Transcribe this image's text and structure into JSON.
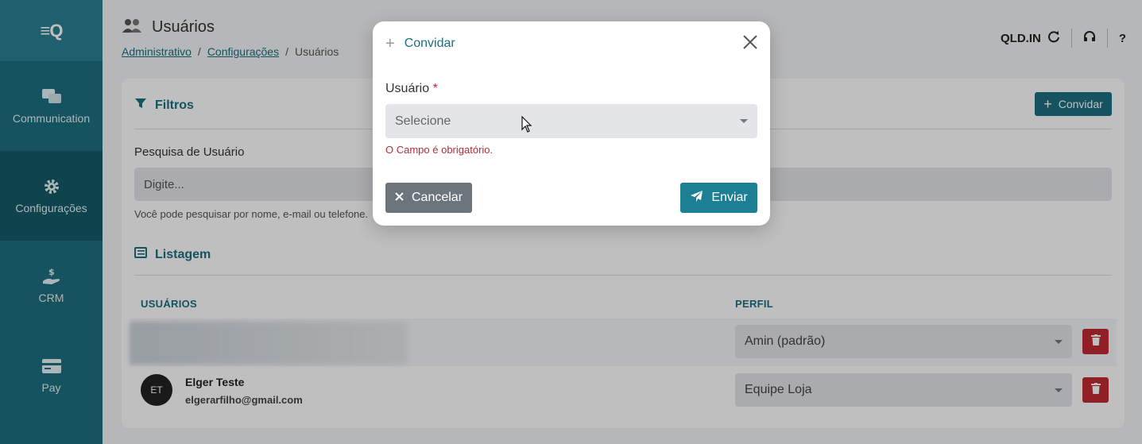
{
  "sidebar": {
    "logo": "≡Q",
    "items": [
      {
        "label": "Communication",
        "icon": "chat-icon"
      },
      {
        "label": "Configurações",
        "icon": "gear-icon"
      },
      {
        "label": "CRM",
        "icon": "money-hand-icon"
      },
      {
        "label": "Pay",
        "icon": "card-icon"
      }
    ]
  },
  "header": {
    "title": "Usuários",
    "breadcrumb": [
      "Administrativo",
      "Configurações",
      "Usuários"
    ],
    "separator": "/",
    "org": "QLD.IN",
    "help": "?"
  },
  "filters": {
    "title": "Filtros",
    "invite_label": "Convidar",
    "search_label": "Pesquisa de Usuário",
    "search_placeholder": "Digite...",
    "helper": "Você pode pesquisar por nome, e-mail ou telefone."
  },
  "listing": {
    "title": "Listagem",
    "col_users": "USUÁRIOS",
    "col_profile": "PERFIL",
    "rows": [
      {
        "initials": "",
        "name": "",
        "email": "",
        "profile": "Amin (padrão)"
      },
      {
        "initials": "ET",
        "name": "Elger Teste",
        "email": "elgerarfilho@gmail.com",
        "profile": "Equipe Loja"
      }
    ]
  },
  "modal": {
    "title": "Convidar",
    "field_label": "Usuário",
    "required_mark": "*",
    "select_placeholder": "Selecione",
    "error": "O Campo é obrigatório.",
    "cancel_label": "Cancelar",
    "send_label": "Enviar"
  },
  "colors": {
    "brand": "#1d6f80",
    "danger": "#c22a33",
    "cancel": "#6c747c"
  }
}
